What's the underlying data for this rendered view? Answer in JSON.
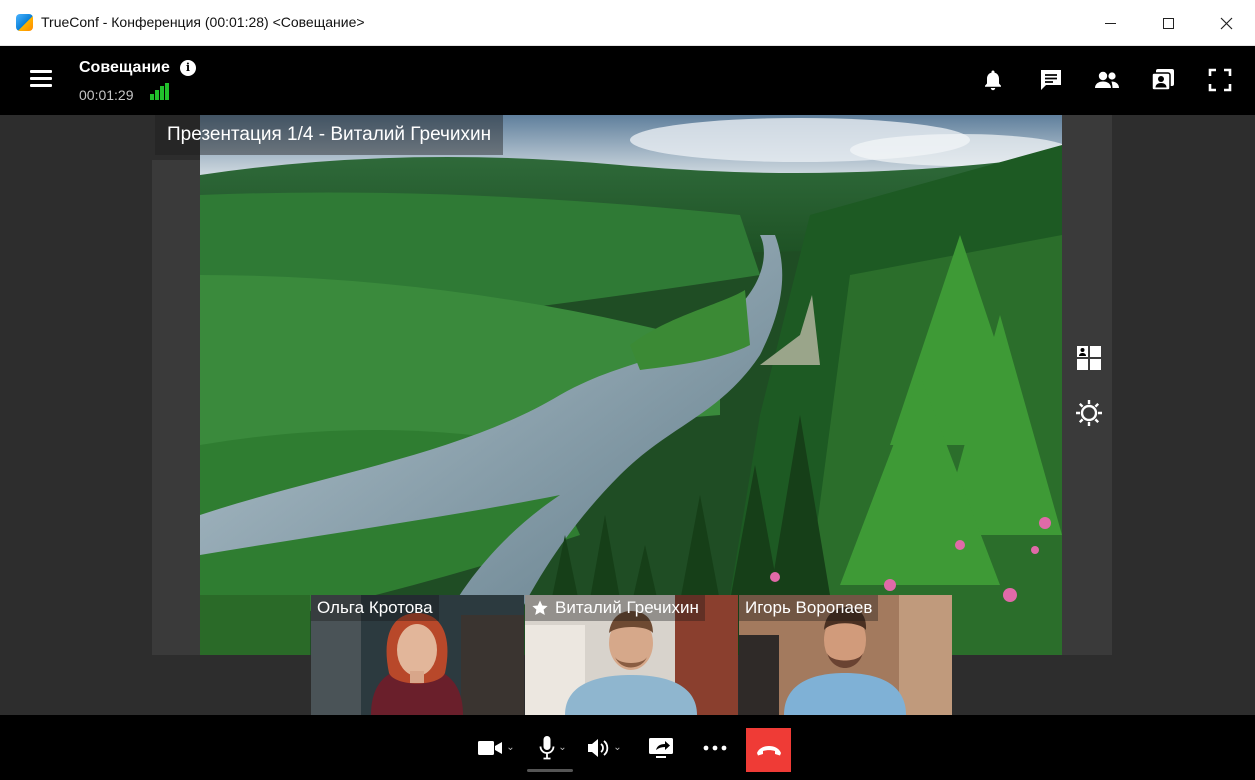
{
  "window": {
    "title": "TrueConf - Конференция (00:01:28) <Совещание>"
  },
  "header": {
    "conference_name": "Совещание",
    "timer": "00:01:29",
    "icons": [
      "menu-icon",
      "info-icon",
      "signal-strength-icon",
      "bell-icon",
      "chat-icon",
      "participants-icon",
      "contacts-icon",
      "fullscreen-icon"
    ]
  },
  "presentation": {
    "label": "Презентация 1/4 - Виталий Гречихин"
  },
  "side_tools": [
    "layout-icon",
    "brightness-icon"
  ],
  "participants": [
    {
      "name": "Ольга Кротова",
      "is_presenter": false
    },
    {
      "name": "Виталий Гречихин",
      "is_presenter": true
    },
    {
      "name": "Игорь Воропаев",
      "is_presenter": false
    }
  ],
  "controls": [
    "camera-icon",
    "microphone-icon",
    "speaker-icon",
    "screen-share-icon",
    "more-icon",
    "hang-up-icon"
  ],
  "colors": {
    "accent_hangup": "#ef3b36",
    "signal": "#21c02c",
    "header_bg": "#000000",
    "stage_bg": "#2d2d2d"
  }
}
